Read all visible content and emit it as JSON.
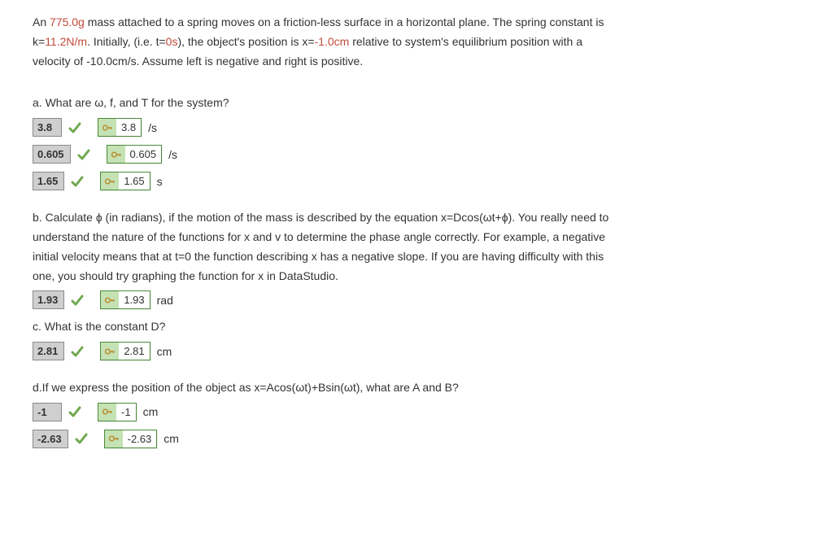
{
  "problem": {
    "line1_pre": "An ",
    "mass": "775.0g",
    "line1_mid": " mass attached to a spring moves on a friction-less surface in a horizontal plane. The spring constant is",
    "line2_pre": "k=",
    "k": "11.2N/m",
    "line2_mid": ". Initially, (i.e. t=",
    "t0": "0s",
    "line2_mid2": "), the object's position is x=",
    "x0": "-1.0cm",
    "line2_post": " relative to system's equilibrium position with a",
    "line3": "velocity of -10.0cm/s. Assume left is negative and right is positive."
  },
  "a": {
    "question": "a. What are ω, f, and T for the system?",
    "rows": [
      {
        "input": "3.8",
        "answer": "3.8",
        "unit": "/s"
      },
      {
        "input": "0.605",
        "answer": "0.605",
        "unit": "/s"
      },
      {
        "input": "1.65",
        "answer": "1.65",
        "unit": "s"
      }
    ]
  },
  "b": {
    "question_l1_pre": "b. Calculate ",
    "question_l1_post": " (in radians), if the motion of the mass is described by the equation x=Dcos(ωt+",
    "question_l1_end": "). You really need to",
    "question_l2": "understand the nature of the functions for x and v to determine the phase angle correctly. For example, a negative",
    "question_l3": "initial velocity means that at t=0 the function describing x has a negative slope. If you are having difficulty with this",
    "question_l4": "one, you should try graphing the function for x in DataStudio.",
    "row": {
      "input": "1.93",
      "answer": "1.93",
      "unit": "rad"
    }
  },
  "c": {
    "question": "c. What is the constant D?",
    "row": {
      "input": "2.81",
      "answer": "2.81",
      "unit": "cm"
    }
  },
  "d": {
    "question": "d.If we express the position of the object as x=Acos(ωt)+Bsin(ωt), what are A and B?",
    "rows": [
      {
        "input": "-1",
        "answer": "-1",
        "unit": "cm"
      },
      {
        "input": "-2.63",
        "answer": "-2.63",
        "unit": "cm"
      }
    ]
  }
}
